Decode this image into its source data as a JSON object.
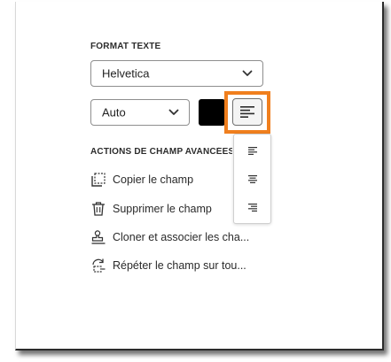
{
  "format_section": {
    "title": "FORMAT TEXTE",
    "font_select": {
      "value": "Helvetica",
      "icon": "chevron-down-icon"
    },
    "size_select": {
      "value": "Auto",
      "icon": "chevron-down-icon"
    },
    "color_swatch": {
      "color": "#000000"
    },
    "align_button": {
      "icon": "align-left-icon",
      "highlight_color": "#f07f1e"
    },
    "align_menu": {
      "options": [
        {
          "icon": "align-left-icon"
        },
        {
          "icon": "align-center-icon"
        },
        {
          "icon": "align-right-icon"
        }
      ]
    }
  },
  "actions_section": {
    "title": "ACTIONS DE CHAMP AVANCÉES",
    "items": [
      {
        "label": "Copier le champ",
        "icon": "copy-field-icon"
      },
      {
        "label": "Supprimer le champ",
        "icon": "trash-icon"
      },
      {
        "label": "Cloner et associer les cha...",
        "icon": "clone-stamp-icon"
      },
      {
        "label": "Répéter le champ sur tou...",
        "icon": "repeat-icon"
      }
    ]
  }
}
